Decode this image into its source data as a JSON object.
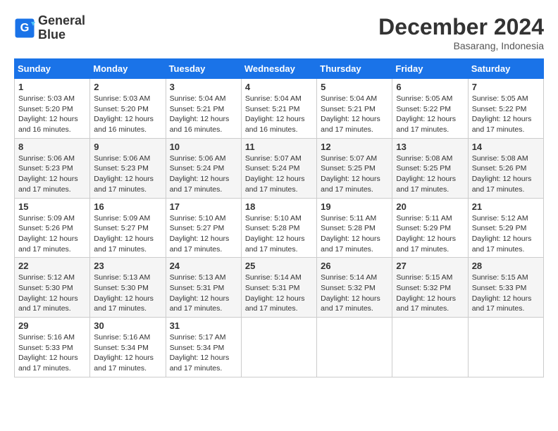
{
  "header": {
    "logo_line1": "General",
    "logo_line2": "Blue",
    "title": "December 2024",
    "subtitle": "Basarang, Indonesia"
  },
  "days_of_week": [
    "Sunday",
    "Monday",
    "Tuesday",
    "Wednesday",
    "Thursday",
    "Friday",
    "Saturday"
  ],
  "weeks": [
    [
      {
        "day": 1,
        "sunrise": "5:03 AM",
        "sunset": "5:20 PM",
        "daylight": "12 hours and 16 minutes."
      },
      {
        "day": 2,
        "sunrise": "5:03 AM",
        "sunset": "5:20 PM",
        "daylight": "12 hours and 16 minutes."
      },
      {
        "day": 3,
        "sunrise": "5:04 AM",
        "sunset": "5:21 PM",
        "daylight": "12 hours and 16 minutes."
      },
      {
        "day": 4,
        "sunrise": "5:04 AM",
        "sunset": "5:21 PM",
        "daylight": "12 hours and 16 minutes."
      },
      {
        "day": 5,
        "sunrise": "5:04 AM",
        "sunset": "5:21 PM",
        "daylight": "12 hours and 17 minutes."
      },
      {
        "day": 6,
        "sunrise": "5:05 AM",
        "sunset": "5:22 PM",
        "daylight": "12 hours and 17 minutes."
      },
      {
        "day": 7,
        "sunrise": "5:05 AM",
        "sunset": "5:22 PM",
        "daylight": "12 hours and 17 minutes."
      }
    ],
    [
      {
        "day": 8,
        "sunrise": "5:06 AM",
        "sunset": "5:23 PM",
        "daylight": "12 hours and 17 minutes."
      },
      {
        "day": 9,
        "sunrise": "5:06 AM",
        "sunset": "5:23 PM",
        "daylight": "12 hours and 17 minutes."
      },
      {
        "day": 10,
        "sunrise": "5:06 AM",
        "sunset": "5:24 PM",
        "daylight": "12 hours and 17 minutes."
      },
      {
        "day": 11,
        "sunrise": "5:07 AM",
        "sunset": "5:24 PM",
        "daylight": "12 hours and 17 minutes."
      },
      {
        "day": 12,
        "sunrise": "5:07 AM",
        "sunset": "5:25 PM",
        "daylight": "12 hours and 17 minutes."
      },
      {
        "day": 13,
        "sunrise": "5:08 AM",
        "sunset": "5:25 PM",
        "daylight": "12 hours and 17 minutes."
      },
      {
        "day": 14,
        "sunrise": "5:08 AM",
        "sunset": "5:26 PM",
        "daylight": "12 hours and 17 minutes."
      }
    ],
    [
      {
        "day": 15,
        "sunrise": "5:09 AM",
        "sunset": "5:26 PM",
        "daylight": "12 hours and 17 minutes."
      },
      {
        "day": 16,
        "sunrise": "5:09 AM",
        "sunset": "5:27 PM",
        "daylight": "12 hours and 17 minutes."
      },
      {
        "day": 17,
        "sunrise": "5:10 AM",
        "sunset": "5:27 PM",
        "daylight": "12 hours and 17 minutes."
      },
      {
        "day": 18,
        "sunrise": "5:10 AM",
        "sunset": "5:28 PM",
        "daylight": "12 hours and 17 minutes."
      },
      {
        "day": 19,
        "sunrise": "5:11 AM",
        "sunset": "5:28 PM",
        "daylight": "12 hours and 17 minutes."
      },
      {
        "day": 20,
        "sunrise": "5:11 AM",
        "sunset": "5:29 PM",
        "daylight": "12 hours and 17 minutes."
      },
      {
        "day": 21,
        "sunrise": "5:12 AM",
        "sunset": "5:29 PM",
        "daylight": "12 hours and 17 minutes."
      }
    ],
    [
      {
        "day": 22,
        "sunrise": "5:12 AM",
        "sunset": "5:30 PM",
        "daylight": "12 hours and 17 minutes."
      },
      {
        "day": 23,
        "sunrise": "5:13 AM",
        "sunset": "5:30 PM",
        "daylight": "12 hours and 17 minutes."
      },
      {
        "day": 24,
        "sunrise": "5:13 AM",
        "sunset": "5:31 PM",
        "daylight": "12 hours and 17 minutes."
      },
      {
        "day": 25,
        "sunrise": "5:14 AM",
        "sunset": "5:31 PM",
        "daylight": "12 hours and 17 minutes."
      },
      {
        "day": 26,
        "sunrise": "5:14 AM",
        "sunset": "5:32 PM",
        "daylight": "12 hours and 17 minutes."
      },
      {
        "day": 27,
        "sunrise": "5:15 AM",
        "sunset": "5:32 PM",
        "daylight": "12 hours and 17 minutes."
      },
      {
        "day": 28,
        "sunrise": "5:15 AM",
        "sunset": "5:33 PM",
        "daylight": "12 hours and 17 minutes."
      }
    ],
    [
      {
        "day": 29,
        "sunrise": "5:16 AM",
        "sunset": "5:33 PM",
        "daylight": "12 hours and 17 minutes."
      },
      {
        "day": 30,
        "sunrise": "5:16 AM",
        "sunset": "5:34 PM",
        "daylight": "12 hours and 17 minutes."
      },
      {
        "day": 31,
        "sunrise": "5:17 AM",
        "sunset": "5:34 PM",
        "daylight": "12 hours and 17 minutes."
      },
      null,
      null,
      null,
      null
    ]
  ]
}
